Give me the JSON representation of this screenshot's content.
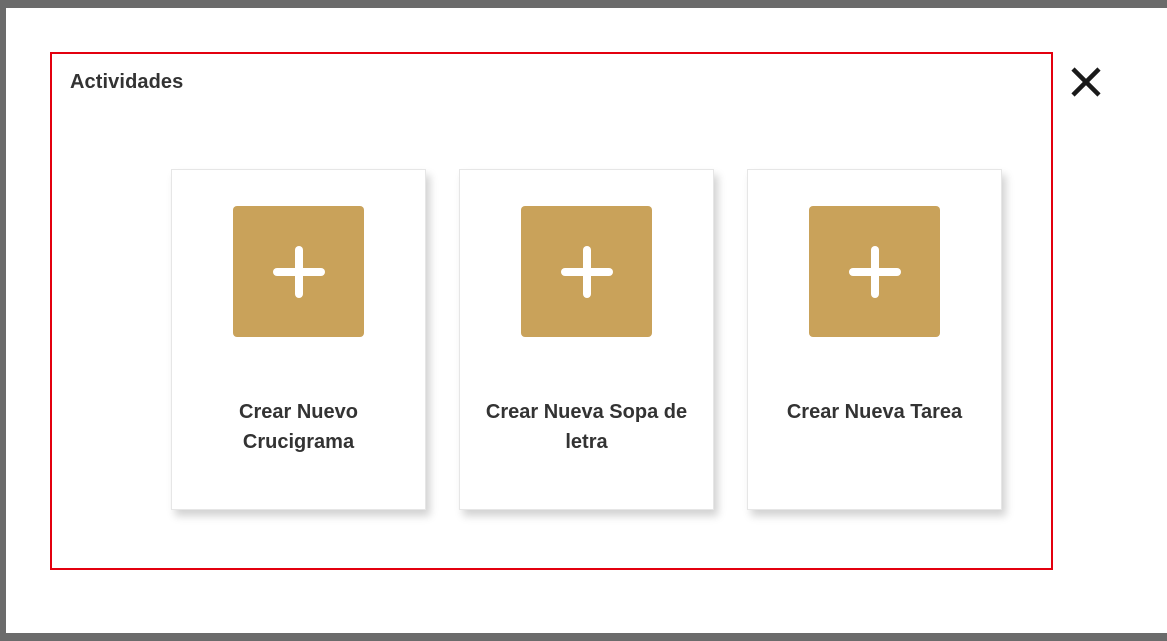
{
  "dialog": {
    "title": "Actividades",
    "close_icon": "close-icon",
    "accent_color": "#c9a25a",
    "highlight_color": "#e3000f"
  },
  "cards": [
    {
      "label": "Crear Nuevo Crucigrama",
      "icon": "plus-icon"
    },
    {
      "label": "Crear Nueva Sopa de letra",
      "icon": "plus-icon"
    },
    {
      "label": "Crear Nueva Tarea",
      "icon": "plus-icon"
    }
  ]
}
